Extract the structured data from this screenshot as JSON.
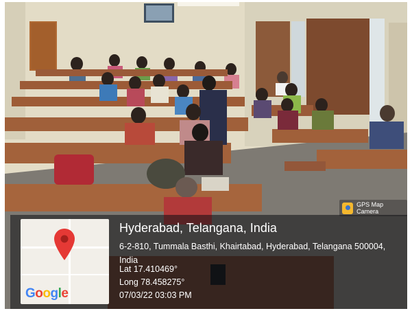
{
  "photo": {
    "description_icon": "classroom-photo"
  },
  "stamp": {
    "title": "Hyderabad, Telangana, India",
    "address": "6-2-810, Tummala Basthi, Khairtabad, Hyderabad, Telangana 500004, India",
    "latitude": "Lat 17.410469°",
    "longitude": "Long 78.458275°",
    "datetime": "07/03/22 03:03 PM",
    "map_logo": "Google",
    "app_name": "GPS Map Camera",
    "colors": {
      "pin": "#e53935",
      "overlay": "#0c0e12"
    }
  }
}
